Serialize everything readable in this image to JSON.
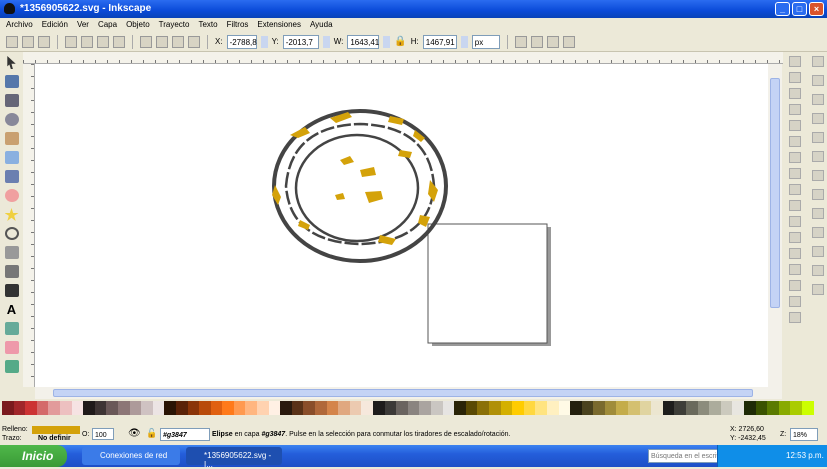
{
  "window": {
    "title": "*1356905622.svg - Inkscape"
  },
  "menu": [
    "Archivo",
    "Edición",
    "Ver",
    "Capa",
    "Objeto",
    "Trayecto",
    "Texto",
    "Filtros",
    "Extensiones",
    "Ayuda"
  ],
  "toolbar": {
    "x_label": "X:",
    "x": "-2788,8",
    "y_label": "Y:",
    "y": "-2013,7",
    "w_label": "W:",
    "w": "1643,41",
    "h_label": "H:",
    "h": "1467,91",
    "unit": "px"
  },
  "status": {
    "fill_label": "Relleno:",
    "stroke_label": "Trazo:",
    "stroke_value": "No definir",
    "fill_color": "#d4a20a",
    "opacity_label": "O:",
    "opacity": "100",
    "layer": "#g3847",
    "message_obj": "Elipse",
    "message_mid": " en capa ",
    "message_layer": "#g3847",
    "message_end": ". Pulse en la selección para conmutar los tiradores de escalado/rotación.",
    "cx": "X:  2726,60",
    "cy": "Y: -2432,45",
    "zoom_label": "Z:",
    "zoom": "18%"
  },
  "taskbar": {
    "start": "Inicio",
    "tasks": [
      "Conexiones de red",
      "*1356905622.svg - I..."
    ],
    "search_placeholder": "Búsqueda en el escrit",
    "clock": "12:53 p.m."
  },
  "palette": [
    "#7a1a1e",
    "#a0262a",
    "#cc3333",
    "#d46a6a",
    "#e29b9b",
    "#edc0c0",
    "#f6e3e3",
    "#201a1a",
    "#3e3434",
    "#6a5858",
    "#8c7676",
    "#ad9a9a",
    "#cfc2c2",
    "#ece4e4",
    "#2a1405",
    "#5a2208",
    "#8a3408",
    "#b84a0a",
    "#e06010",
    "#ff7a1a",
    "#ff9a50",
    "#ffb680",
    "#ffd2b0",
    "#fff0e4",
    "#2a1a0e",
    "#5a3218",
    "#8a4e2a",
    "#b0683a",
    "#d4844a",
    "#e0a880",
    "#eccab0",
    "#f6e8dc",
    "#1e1c1c",
    "#3c3a38",
    "#6a6460",
    "#8a8480",
    "#aaa4a0",
    "#cac6c2",
    "#e6e4e2",
    "#2a2408",
    "#5a4a04",
    "#8a7008",
    "#b09008",
    "#d4b000",
    "#ffcc00",
    "#ffd840",
    "#ffe480",
    "#fff0c0",
    "#fffae6",
    "#24200e",
    "#4a421e",
    "#7a6a2e",
    "#a08c3a",
    "#c4ac4a",
    "#d4c070",
    "#e0d4a0",
    "#ece6d0",
    "#1e1e1c",
    "#3e3e38",
    "#6a6a5c",
    "#8c8c7c",
    "#acac9c",
    "#cccabe",
    "#e8e6e0",
    "#1e2a06",
    "#3a5200",
    "#5a7a00",
    "#88aa00",
    "#aacc00",
    "#ccff00"
  ]
}
